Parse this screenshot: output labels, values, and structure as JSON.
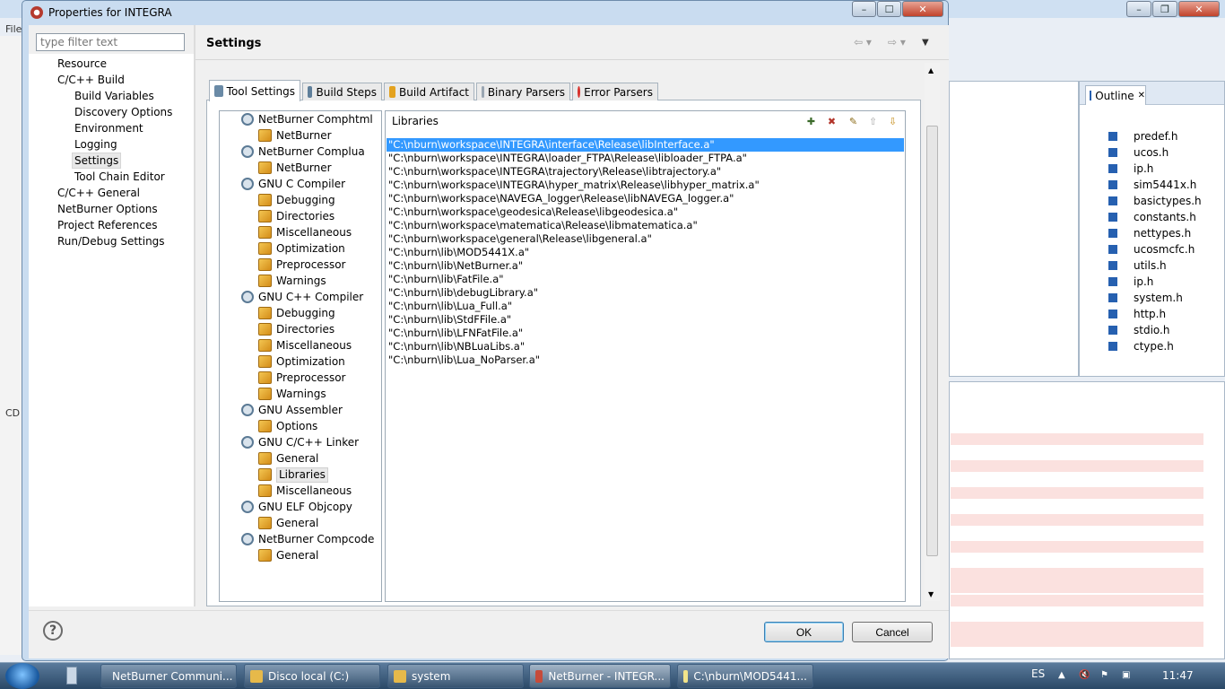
{
  "dialog": {
    "title": "Properties for INTEGRA",
    "filter_placeholder": "type filter text",
    "nav_items": [
      {
        "label": "Resource",
        "indent": 0
      },
      {
        "label": "C/C++ Build",
        "indent": 0
      },
      {
        "label": "Build Variables",
        "indent": 1
      },
      {
        "label": "Discovery Options",
        "indent": 1
      },
      {
        "label": "Environment",
        "indent": 1
      },
      {
        "label": "Logging",
        "indent": 1
      },
      {
        "label": "Settings",
        "indent": 1,
        "selected": true
      },
      {
        "label": "Tool Chain Editor",
        "indent": 1
      },
      {
        "label": "C/C++ General",
        "indent": 0
      },
      {
        "label": "NetBurner Options",
        "indent": 0
      },
      {
        "label": "Project References",
        "indent": 0
      },
      {
        "label": "Run/Debug Settings",
        "indent": 0
      }
    ],
    "page_title": "Settings",
    "tabs": [
      {
        "label": "Tool Settings",
        "active": true
      },
      {
        "label": "Build Steps"
      },
      {
        "label": "Build Artifact"
      },
      {
        "label": "Binary Parsers"
      },
      {
        "label": "Error Parsers"
      }
    ],
    "tool_tree": [
      {
        "label": "NetBurner Comphtml",
        "level": 0
      },
      {
        "label": "NetBurner",
        "level": 1
      },
      {
        "label": "NetBurner Complua",
        "level": 0
      },
      {
        "label": "NetBurner",
        "level": 1
      },
      {
        "label": "GNU C Compiler",
        "level": 0
      },
      {
        "label": "Debugging",
        "level": 1
      },
      {
        "label": "Directories",
        "level": 1
      },
      {
        "label": "Miscellaneous",
        "level": 1
      },
      {
        "label": "Optimization",
        "level": 1
      },
      {
        "label": "Preprocessor",
        "level": 1
      },
      {
        "label": "Warnings",
        "level": 1
      },
      {
        "label": "GNU C++ Compiler",
        "level": 0
      },
      {
        "label": "Debugging",
        "level": 1
      },
      {
        "label": "Directories",
        "level": 1
      },
      {
        "label": "Miscellaneous",
        "level": 1
      },
      {
        "label": "Optimization",
        "level": 1
      },
      {
        "label": "Preprocessor",
        "level": 1
      },
      {
        "label": "Warnings",
        "level": 1
      },
      {
        "label": "GNU Assembler",
        "level": 0
      },
      {
        "label": "Options",
        "level": 1
      },
      {
        "label": "GNU C/C++ Linker",
        "level": 0
      },
      {
        "label": "General",
        "level": 1
      },
      {
        "label": "Libraries",
        "level": 1,
        "selected": true
      },
      {
        "label": "Miscellaneous",
        "level": 1
      },
      {
        "label": "GNU ELF Objcopy",
        "level": 0
      },
      {
        "label": "General",
        "level": 1
      },
      {
        "label": "NetBurner Compcode",
        "level": 0
      },
      {
        "label": "General",
        "level": 1
      }
    ],
    "libraries_label": "Libraries",
    "libraries": [
      "\"C:\\nburn\\workspace\\INTEGRA\\interface\\Release\\libInterface.a\"",
      "\"C:\\nburn\\workspace\\INTEGRA\\loader_FTPA\\Release\\libloader_FTPA.a\"",
      "\"C:\\nburn\\workspace\\INTEGRA\\trajectory\\Release\\libtrajectory.a\"",
      "\"C:\\nburn\\workspace\\INTEGRA\\hyper_matrix\\Release\\libhyper_matrix.a\"",
      "\"C:\\nburn\\workspace\\NAVEGA_logger\\Release\\libNAVEGA_logger.a\"",
      "\"C:\\nburn\\workspace\\geodesica\\Release\\libgeodesica.a\"",
      "\"C:\\nburn\\workspace\\matematica\\Release\\libmatematica.a\"",
      "\"C:\\nburn\\workspace\\general\\Release\\libgeneral.a\"",
      "\"C:\\nburn\\lib\\MOD5441X.a\"",
      "\"C:\\nburn\\lib\\NetBurner.a\"",
      "\"C:\\nburn\\lib\\FatFile.a\"",
      "\"C:\\nburn\\lib\\debugLibrary.a\"",
      "\"C:\\nburn\\lib\\Lua_Full.a\"",
      "\"C:\\nburn\\lib\\StdFFile.a\"",
      "\"C:\\nburn\\lib\\LFNFatFile.a\"",
      "\"C:\\nburn\\lib\\NBLuaLibs.a\"",
      "\"C:\\nburn\\lib\\Lua_NoParser.a\""
    ],
    "ok_label": "OK",
    "cancel_label": "Cancel"
  },
  "background": {
    "outline_title": "Outline",
    "outline_items": [
      "predef.h",
      "ucos.h",
      "ip.h",
      "sim5441x.h",
      "basictypes.h",
      "constants.h",
      "nettypes.h",
      "ucosmcfc.h",
      "utils.h",
      "ip.h",
      "system.h",
      "http.h",
      "stdio.h",
      "ctype.h"
    ],
    "menu_file": "File",
    "console_prefix": "CD"
  },
  "taskbar": {
    "items": [
      {
        "label": "NetBurner Communi...",
        "color": "#d93a2e"
      },
      {
        "label": "Disco local (C:)",
        "color": "#e6b94a"
      },
      {
        "label": "system",
        "color": "#e6b94a"
      },
      {
        "label": "NetBurner - INTEGR...",
        "color": "#c64b3a",
        "active": true
      },
      {
        "label": "C:\\nburn\\MOD5441...",
        "color": "#f2e48a"
      }
    ],
    "lang": "ES",
    "time": "11:47"
  }
}
